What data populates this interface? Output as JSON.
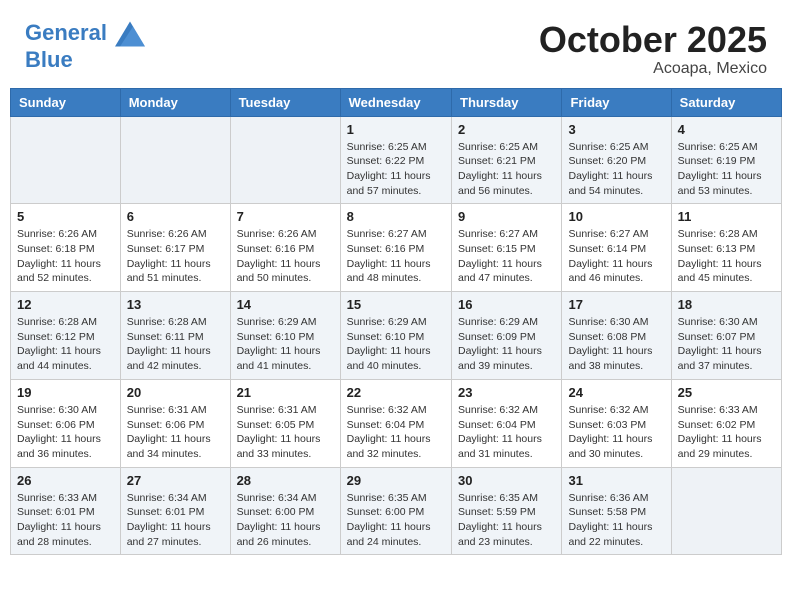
{
  "logo": {
    "line1": "General",
    "line2": "Blue"
  },
  "title": "October 2025",
  "subtitle": "Acoapa, Mexico",
  "days_of_week": [
    "Sunday",
    "Monday",
    "Tuesday",
    "Wednesday",
    "Thursday",
    "Friday",
    "Saturday"
  ],
  "weeks": [
    [
      {
        "day": "",
        "info": ""
      },
      {
        "day": "",
        "info": ""
      },
      {
        "day": "",
        "info": ""
      },
      {
        "day": "1",
        "info": "Sunrise: 6:25 AM\nSunset: 6:22 PM\nDaylight: 11 hours and 57 minutes."
      },
      {
        "day": "2",
        "info": "Sunrise: 6:25 AM\nSunset: 6:21 PM\nDaylight: 11 hours and 56 minutes."
      },
      {
        "day": "3",
        "info": "Sunrise: 6:25 AM\nSunset: 6:20 PM\nDaylight: 11 hours and 54 minutes."
      },
      {
        "day": "4",
        "info": "Sunrise: 6:25 AM\nSunset: 6:19 PM\nDaylight: 11 hours and 53 minutes."
      }
    ],
    [
      {
        "day": "5",
        "info": "Sunrise: 6:26 AM\nSunset: 6:18 PM\nDaylight: 11 hours and 52 minutes."
      },
      {
        "day": "6",
        "info": "Sunrise: 6:26 AM\nSunset: 6:17 PM\nDaylight: 11 hours and 51 minutes."
      },
      {
        "day": "7",
        "info": "Sunrise: 6:26 AM\nSunset: 6:16 PM\nDaylight: 11 hours and 50 minutes."
      },
      {
        "day": "8",
        "info": "Sunrise: 6:27 AM\nSunset: 6:16 PM\nDaylight: 11 hours and 48 minutes."
      },
      {
        "day": "9",
        "info": "Sunrise: 6:27 AM\nSunset: 6:15 PM\nDaylight: 11 hours and 47 minutes."
      },
      {
        "day": "10",
        "info": "Sunrise: 6:27 AM\nSunset: 6:14 PM\nDaylight: 11 hours and 46 minutes."
      },
      {
        "day": "11",
        "info": "Sunrise: 6:28 AM\nSunset: 6:13 PM\nDaylight: 11 hours and 45 minutes."
      }
    ],
    [
      {
        "day": "12",
        "info": "Sunrise: 6:28 AM\nSunset: 6:12 PM\nDaylight: 11 hours and 44 minutes."
      },
      {
        "day": "13",
        "info": "Sunrise: 6:28 AM\nSunset: 6:11 PM\nDaylight: 11 hours and 42 minutes."
      },
      {
        "day": "14",
        "info": "Sunrise: 6:29 AM\nSunset: 6:10 PM\nDaylight: 11 hours and 41 minutes."
      },
      {
        "day": "15",
        "info": "Sunrise: 6:29 AM\nSunset: 6:10 PM\nDaylight: 11 hours and 40 minutes."
      },
      {
        "day": "16",
        "info": "Sunrise: 6:29 AM\nSunset: 6:09 PM\nDaylight: 11 hours and 39 minutes."
      },
      {
        "day": "17",
        "info": "Sunrise: 6:30 AM\nSunset: 6:08 PM\nDaylight: 11 hours and 38 minutes."
      },
      {
        "day": "18",
        "info": "Sunrise: 6:30 AM\nSunset: 6:07 PM\nDaylight: 11 hours and 37 minutes."
      }
    ],
    [
      {
        "day": "19",
        "info": "Sunrise: 6:30 AM\nSunset: 6:06 PM\nDaylight: 11 hours and 36 minutes."
      },
      {
        "day": "20",
        "info": "Sunrise: 6:31 AM\nSunset: 6:06 PM\nDaylight: 11 hours and 34 minutes."
      },
      {
        "day": "21",
        "info": "Sunrise: 6:31 AM\nSunset: 6:05 PM\nDaylight: 11 hours and 33 minutes."
      },
      {
        "day": "22",
        "info": "Sunrise: 6:32 AM\nSunset: 6:04 PM\nDaylight: 11 hours and 32 minutes."
      },
      {
        "day": "23",
        "info": "Sunrise: 6:32 AM\nSunset: 6:04 PM\nDaylight: 11 hours and 31 minutes."
      },
      {
        "day": "24",
        "info": "Sunrise: 6:32 AM\nSunset: 6:03 PM\nDaylight: 11 hours and 30 minutes."
      },
      {
        "day": "25",
        "info": "Sunrise: 6:33 AM\nSunset: 6:02 PM\nDaylight: 11 hours and 29 minutes."
      }
    ],
    [
      {
        "day": "26",
        "info": "Sunrise: 6:33 AM\nSunset: 6:01 PM\nDaylight: 11 hours and 28 minutes."
      },
      {
        "day": "27",
        "info": "Sunrise: 6:34 AM\nSunset: 6:01 PM\nDaylight: 11 hours and 27 minutes."
      },
      {
        "day": "28",
        "info": "Sunrise: 6:34 AM\nSunset: 6:00 PM\nDaylight: 11 hours and 26 minutes."
      },
      {
        "day": "29",
        "info": "Sunrise: 6:35 AM\nSunset: 6:00 PM\nDaylight: 11 hours and 24 minutes."
      },
      {
        "day": "30",
        "info": "Sunrise: 6:35 AM\nSunset: 5:59 PM\nDaylight: 11 hours and 23 minutes."
      },
      {
        "day": "31",
        "info": "Sunrise: 6:36 AM\nSunset: 5:58 PM\nDaylight: 11 hours and 22 minutes."
      },
      {
        "day": "",
        "info": ""
      }
    ]
  ]
}
